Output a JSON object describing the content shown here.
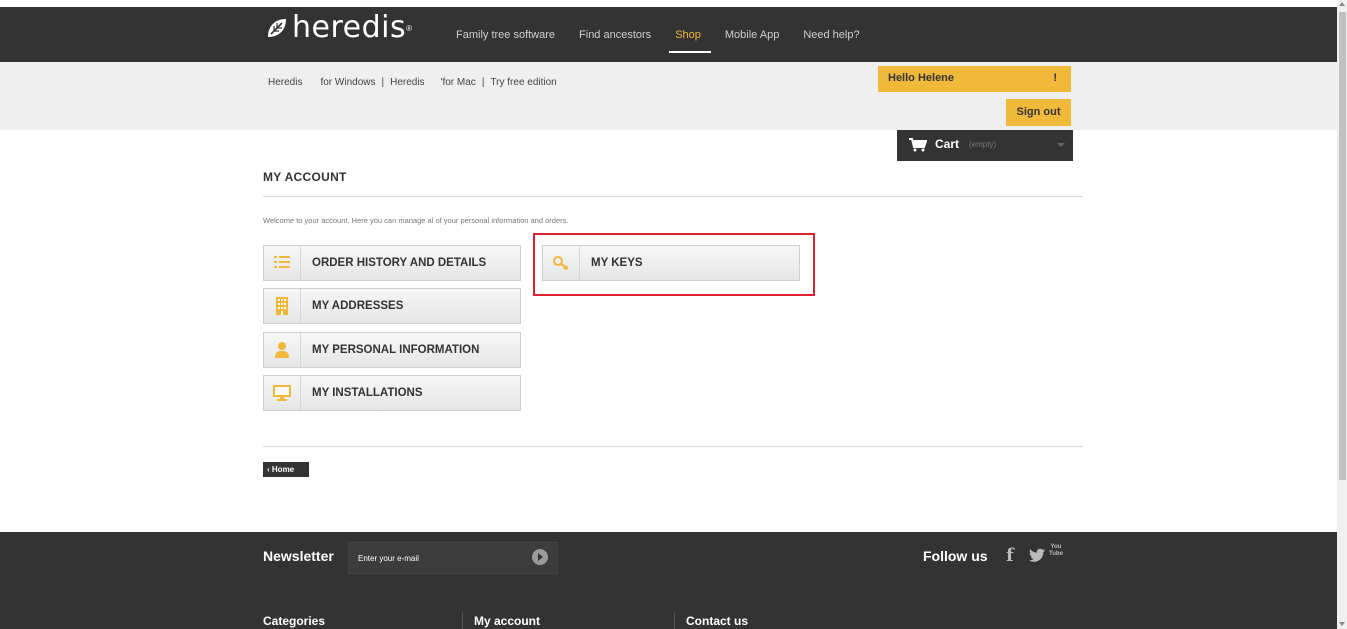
{
  "header": {
    "logo_text": "heredis",
    "logo_reg": "®",
    "nav": [
      {
        "label": "Family tree software",
        "active": false
      },
      {
        "label": "Find ancestors",
        "active": false
      },
      {
        "label": "Shop",
        "active": true
      },
      {
        "label": "Mobile App",
        "active": false
      },
      {
        "label": "Need help?",
        "active": false
      }
    ]
  },
  "subnav": {
    "items": [
      "Heredis",
      "for Windows",
      "|",
      "Heredis",
      "'for Mac",
      "|",
      "Try free edition"
    ]
  },
  "user": {
    "hello": "Hello Helene",
    "hello_suffix": "!",
    "signout": "Sign out"
  },
  "cart": {
    "label": "Cart",
    "status": "(empty)"
  },
  "main": {
    "title": "MY ACCOUNT",
    "welcome": "Welcome to your account. Here you can manage al of your personal information and orders.",
    "buttons": {
      "orders": "ORDER HISTORY AND DETAILS",
      "addresses": "MY ADDRESSES",
      "personal": "MY PERSONAL INFORMATION",
      "installations": "MY INSTALLATIONS",
      "keys": "MY KEYS"
    },
    "home": "Home"
  },
  "footer": {
    "newsletter": "Newsletter",
    "newsletter_placeholder": "Enter your e-mail",
    "follow": "Follow us",
    "social": [
      "f",
      "twitter",
      "You Tube"
    ],
    "columns": [
      "Categories",
      "My account",
      "Contact us"
    ]
  },
  "colors": {
    "accent": "#f0b93a",
    "dark": "#333333",
    "highlight": "#e0202a"
  }
}
